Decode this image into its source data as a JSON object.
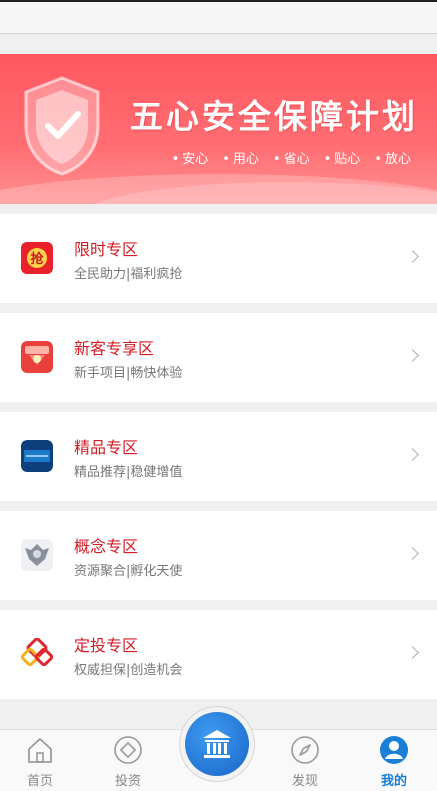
{
  "banner": {
    "title": "五心安全保障计划",
    "tags": [
      "安心",
      "用心",
      "省心",
      "贴心",
      "放心"
    ],
    "shield_icon": "shield-check-icon"
  },
  "sections": [
    {
      "name": "限时专区",
      "desc": "全民助力|福利疯抢",
      "icon": "qiang-badge-icon",
      "icon_char": "抢"
    },
    {
      "name": "新客专享区",
      "desc": "新手项目|畅快体验",
      "icon": "red-envelope-icon"
    },
    {
      "name": "精品专区",
      "desc": "精品推荐|稳健增值",
      "icon": "blue-card-icon"
    },
    {
      "name": "概念专区",
      "desc": "资源聚合|孵化天使",
      "icon": "silver-emblem-icon"
    },
    {
      "name": "定投专区",
      "desc": "权威担保|创造机会",
      "icon": "interlock-logo-icon"
    }
  ],
  "tabbar": {
    "items": [
      {
        "label": "首页",
        "icon": "home-icon"
      },
      {
        "label": "投资",
        "icon": "diamond-icon"
      },
      {
        "label": "发现",
        "icon": "compass-icon"
      },
      {
        "label": "我的",
        "icon": "user-icon",
        "active": true
      }
    ],
    "center_icon": "bank-icon"
  },
  "colors": {
    "accent": "#d31c25",
    "banner": "#ff5b62",
    "tab_active": "#1a7fd6"
  }
}
